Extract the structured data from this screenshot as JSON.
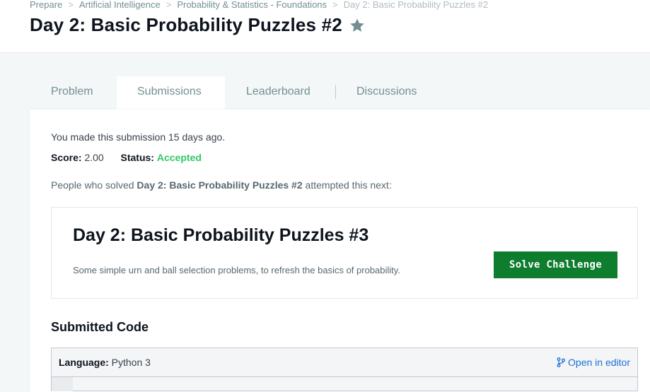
{
  "breadcrumb": {
    "items": [
      "Prepare",
      "Artificial Intelligence",
      "Probability & Statistics - Foundations"
    ],
    "current": "Day 2: Basic Probability Puzzles #2"
  },
  "page": {
    "title": "Day 2: Basic Probability Puzzles #2"
  },
  "tabs": [
    {
      "label": "Problem"
    },
    {
      "label": "Submissions"
    },
    {
      "label": "Leaderboard"
    },
    {
      "label": "Discussions"
    }
  ],
  "submission": {
    "made_text": "You made this submission 15 days ago.",
    "score_label": "Score:",
    "score_value": "2.00",
    "status_label": "Status:",
    "status_value": "Accepted",
    "solved_prefix": "People who solved ",
    "solved_challenge": "Day 2: Basic Probability Puzzles #2",
    "solved_suffix": " attempted this next:"
  },
  "next_challenge": {
    "title": "Day 2: Basic Probability Puzzles #3",
    "description": "Some simple urn and ball selection problems, to refresh the basics of probability.",
    "button_label": "Solve Challenge"
  },
  "code": {
    "heading": "Submitted Code",
    "language_label": "Language:",
    "language_value": "Python 3",
    "open_editor_label": "Open in editor"
  },
  "colors": {
    "accepted": "#2ec866",
    "button": "#0f7d2e",
    "link": "#1f6fd6"
  }
}
